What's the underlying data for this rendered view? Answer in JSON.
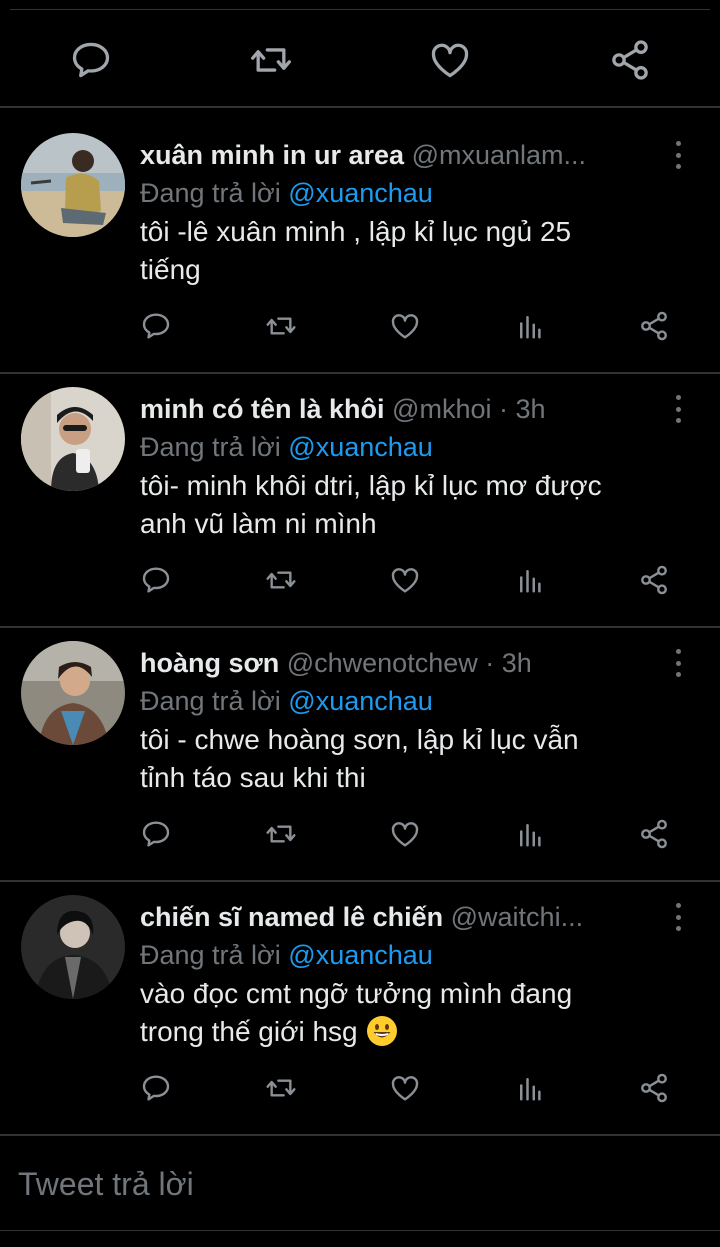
{
  "reply_label": "Đang trả lời",
  "composer": {
    "placeholder": "Tweet trả lời"
  },
  "icons": {
    "reply": "reply-icon",
    "retweet": "retweet-icon",
    "like": "like-icon",
    "views": "views-icon",
    "share": "share-icon",
    "more": "more-icon"
  },
  "colors": {
    "background": "#000000",
    "text": "#e7e9ea",
    "secondary": "#71767b",
    "mention": "#1d9bf0",
    "divider": "#2f3336"
  },
  "tweets": [
    {
      "name": "xuân minh in ur area",
      "handle": "@mxuanlam...",
      "reply_to": "@xuanchau",
      "text_line1": "tôi -lê xuân minh , lập kỉ lục ngủ 25",
      "text_line2": "tiếng"
    },
    {
      "name": "minh có tên là khôi",
      "handle": "@mkhoi · 3h",
      "reply_to": "@xuanchau",
      "text_line1": "tôi- minh khôi dtri, lập kỉ lục mơ được",
      "text_line2": "anh vũ làm ni mình"
    },
    {
      "name": "hoàng sơn",
      "handle": "@chwenotchew · 3h",
      "reply_to": "@xuanchau",
      "text_line1": "tôi - chwe hoàng sơn, lập kỉ lục vẫn",
      "text_line2": "tỉnh táo sau khi thi"
    },
    {
      "name": "chiến sĩ named lê chiến",
      "handle": "@waitchi...",
      "reply_to": "@xuanchau",
      "text_line1": "vào đọc cmt ngỡ tưởng mình đang",
      "text_line2": "trong thế giới hsg"
    }
  ]
}
